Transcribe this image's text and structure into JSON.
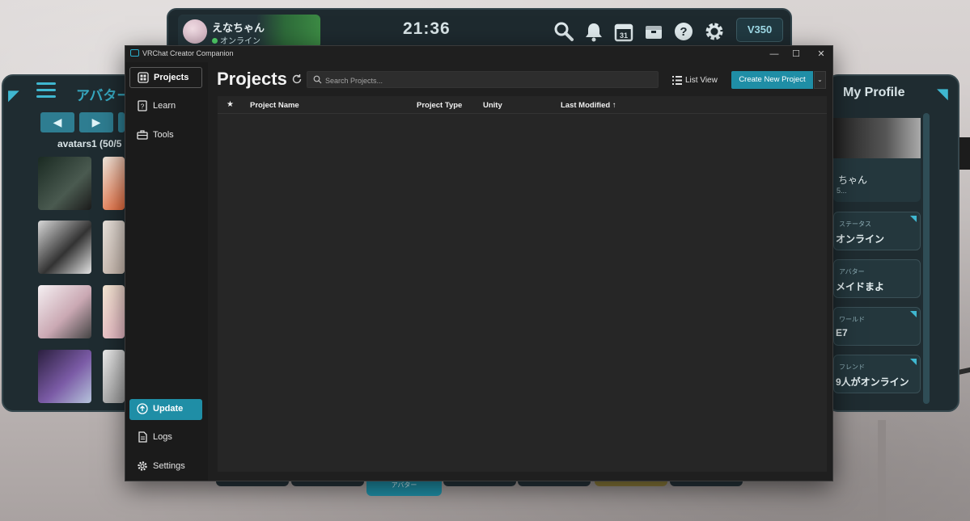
{
  "vr": {
    "topbar": {
      "username": "えなちゃん",
      "status": "オンライン",
      "clock": "21:36",
      "calendar_day": "31",
      "credits": "V350",
      "icons": [
        "search-icon",
        "bell-icon",
        "calendar-icon",
        "inventory-icon",
        "help-icon",
        "gear-icon"
      ]
    },
    "left_panel": {
      "title": "アバター",
      "list_label": "avatars1 (50/5"
    },
    "right_panel": {
      "title": "My Profile",
      "profile_name": "ちゃん",
      "profile_sub": "5...",
      "cards": [
        {
          "label": "ステータス",
          "value": "オンライン"
        },
        {
          "label": "アバター",
          "value": "メイドまよ"
        },
        {
          "label": "ワールド",
          "value": "E7"
        },
        {
          "label": "フレンド",
          "value": "9人がオンライン"
        }
      ]
    },
    "bottom_tab_active": "アバター"
  },
  "window": {
    "title": "VRChat Creator Companion",
    "controls": {
      "minimize": "—",
      "maximize": "☐",
      "close": "✕"
    }
  },
  "sidebar": {
    "items": [
      {
        "label": "Projects",
        "icon": "grid-icon"
      },
      {
        "label": "Learn",
        "icon": "question-book-icon"
      },
      {
        "label": "Tools",
        "icon": "toolbox-icon"
      }
    ],
    "bottom_items": [
      {
        "label": "Update",
        "icon": "arrow-up-circle-icon"
      },
      {
        "label": "Logs",
        "icon": "document-icon"
      },
      {
        "label": "Settings",
        "icon": "gear-icon"
      }
    ]
  },
  "main": {
    "title": "Projects",
    "search_placeholder": "Search Projects...",
    "list_view_label": "List View",
    "create_label": "Create New Project",
    "columns": {
      "name": "Project Name",
      "type": "Project Type",
      "unity": "Unity",
      "modified": "Last Modified ↑"
    }
  },
  "colors": {
    "accent": "#1f8ea6",
    "background": "#1f1f1f",
    "sidebar": "#1b1b1b"
  }
}
